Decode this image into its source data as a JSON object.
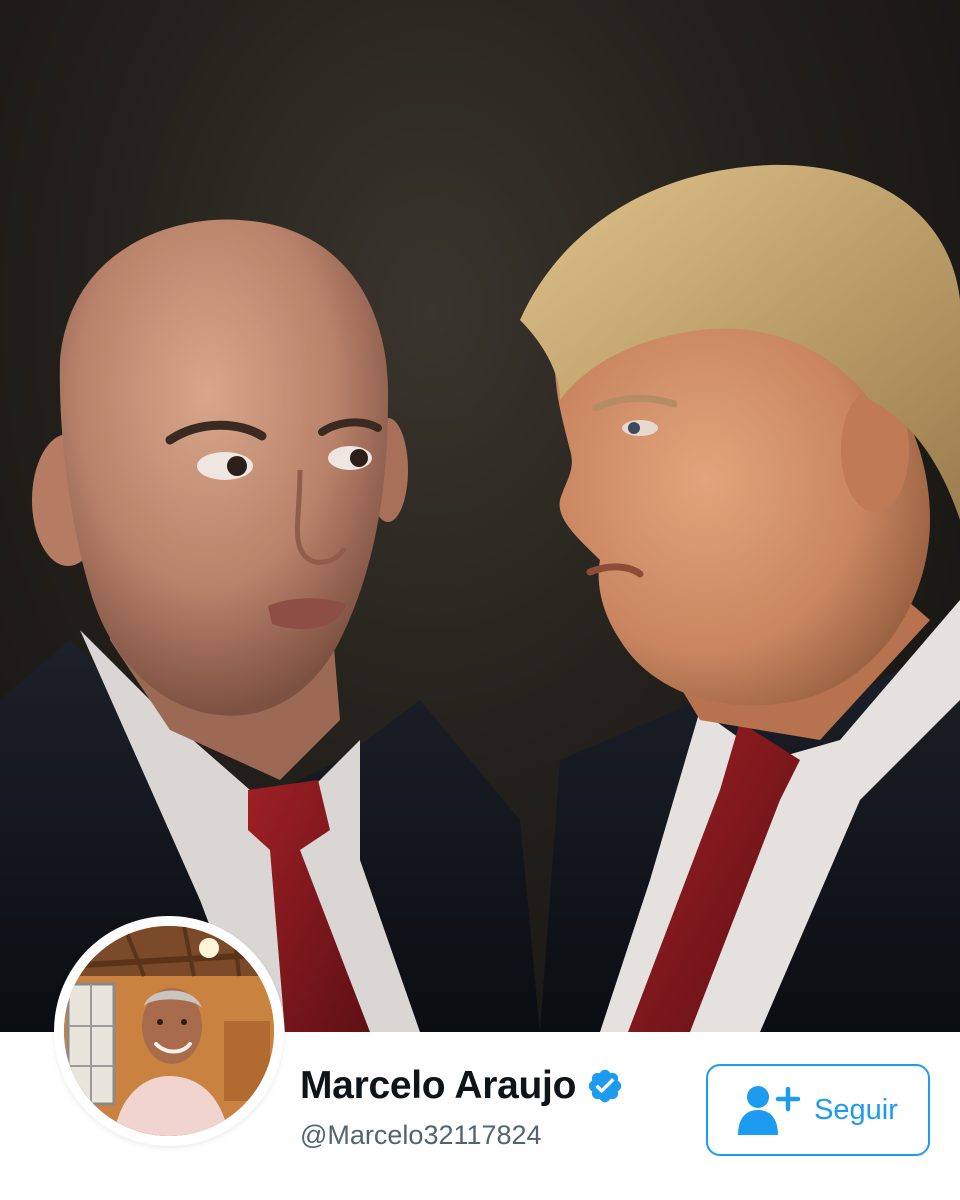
{
  "profile": {
    "display_name": "Marcelo Araujo",
    "handle": "@Marcelo32117824",
    "verified": true,
    "follow_label": "Seguir"
  },
  "icons": {
    "verified": "verified-badge-icon",
    "follow": "person-add-icon"
  },
  "colors": {
    "accent": "#1d9bf0",
    "name_text": "#0f1419",
    "handle_text": "#536471",
    "background": "#ffffff",
    "photo_background": "#1c1a17"
  }
}
